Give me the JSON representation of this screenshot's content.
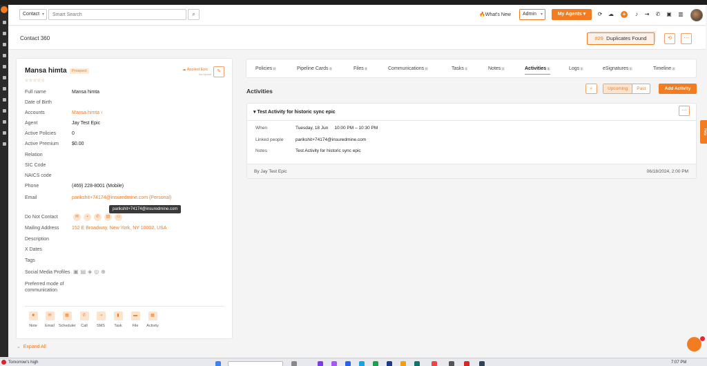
{
  "header": {
    "context_select": "Contact",
    "search_placeholder": "Smart Search",
    "whats_new": "What's New",
    "admin_select": "Admin",
    "my_agents": "My Agents"
  },
  "subheader": {
    "page_title": "Contact 360",
    "duplicates_count": "#29",
    "duplicates_label": "Duplicates Found"
  },
  "contact": {
    "name": "Mansa himta",
    "status": "Prospect",
    "stars": "☆☆☆☆☆",
    "applied_epic": "Applied Epic",
    "applied_epic_sub": "Not Synced",
    "fields": [
      {
        "label": "Full name",
        "value": "Mansa himta"
      },
      {
        "label": "Date of Birth",
        "value": ""
      },
      {
        "label": "Accounts",
        "value": "Mansa himta"
      },
      {
        "label": "Agent",
        "value": "Jay Test Epic"
      },
      {
        "label": "Active Policies",
        "value": "0"
      },
      {
        "label": "Active Premium",
        "value": "$0.00"
      },
      {
        "label": "Relation",
        "value": ""
      },
      {
        "label": "SIC Code",
        "value": ""
      },
      {
        "label": "NAICS code",
        "value": ""
      },
      {
        "label": "Phone",
        "value": "(469) 228-8001 (Mobile)"
      },
      {
        "label": "Email",
        "value": "parikshit+74174@insuredmine.com (Personal)"
      },
      {
        "label": "Do Not Contact",
        "value": ""
      },
      {
        "label": "Mailing Address",
        "value": "152 E Broadway, New York, NY 10002, USA"
      },
      {
        "label": "Description",
        "value": ""
      },
      {
        "label": "X Dates",
        "value": ""
      },
      {
        "label": "Tags",
        "value": ""
      },
      {
        "label": "Social Media Profiles",
        "value": ""
      },
      {
        "label": "Preferred mode of communication",
        "value": ""
      }
    ],
    "email_tooltip": "parikshit+74174@insuredmine.com",
    "quick_actions": [
      "Note",
      "Email",
      "Scheduler",
      "Call",
      "SMS",
      "Task",
      "File",
      "Activity"
    ],
    "expand_all": "Expand All"
  },
  "tabs": [
    {
      "label": "Policies",
      "count": "0"
    },
    {
      "label": "Pipeline Cards",
      "count": "0"
    },
    {
      "label": "Files",
      "count": "0"
    },
    {
      "label": "Communications",
      "count": "0"
    },
    {
      "label": "Tasks",
      "count": "1"
    },
    {
      "label": "Notes",
      "count": "1"
    },
    {
      "label": "Activities",
      "count": "1",
      "active": true
    },
    {
      "label": "Logs",
      "count": "1"
    },
    {
      "label": "eSignatures",
      "count": "1"
    },
    {
      "label": "Timeline",
      "count": "4"
    }
  ],
  "activities": {
    "title": "Activities",
    "filter_upcoming": "Upcoming",
    "filter_past": "Past",
    "add_button": "Add Activity",
    "item": {
      "title": "Test Activity for historic sync epic",
      "when_label": "When",
      "when_value": "Tuesday, 18 Jun     10:00 PM – 10:30 PM",
      "linked_label": "Linked people",
      "linked_value": "parikshit+74174@insuredmine.com",
      "notes_label": "Notes",
      "notes_value": "Test Activity for historic sync epic",
      "by": "By Jay Test Epic",
      "date": "06/18/2024, 2:00 PM"
    }
  },
  "side": {
    "help_label": "Help"
  },
  "taskbar": {
    "weather": "Tomorrow's high",
    "clock": "7:07 PM"
  },
  "colors": {
    "accent": "#f47c20",
    "accent_light": "#fde4cf"
  }
}
